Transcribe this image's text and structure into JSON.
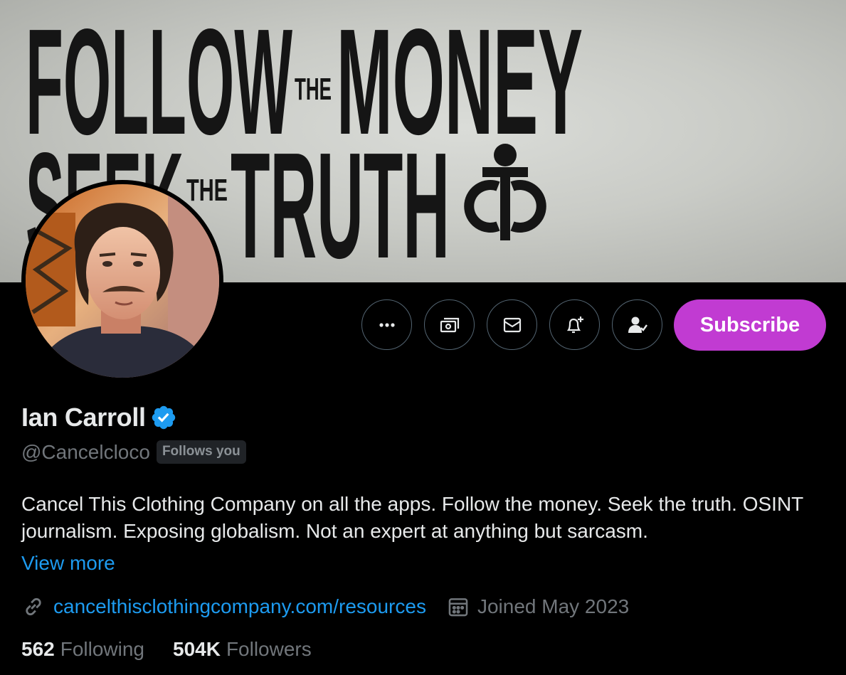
{
  "banner": {
    "line1_a": "FOLLOW",
    "line1_the": "THE",
    "line1_b": "MONEY",
    "line2_a": "SEEK",
    "line2_the": "THE",
    "line2_b": "TRUTH",
    "logo_icon": "ctc-logo-icon"
  },
  "profile": {
    "name": "Ian Carroll",
    "handle": "@Cancelcloco",
    "follows_you": "Follows you",
    "bio": "Cancel This Clothing Company on all the apps. Follow the money. Seek the truth. OSINT journalism. Exposing globalism. Not an expert at anything but sarcasm.",
    "view_more": "View more",
    "website": "cancelthisclothingcompany.com/resources",
    "joined": "Joined May 2023",
    "following_count": "562",
    "following_label": "Following",
    "followers_count": "504K",
    "followers_label": "Followers"
  },
  "actions": {
    "more_icon": "more-icon",
    "tip_icon": "money-icon",
    "message_icon": "envelope-icon",
    "notify_icon": "bell-plus-icon",
    "following_icon": "person-check-icon",
    "subscribe_label": "Subscribe"
  },
  "colors": {
    "background": "#000000",
    "accent_blue": "#1d9bf0",
    "subscribe": "#c13bd2",
    "muted": "#71767b",
    "verified": "#1d9bf0"
  }
}
